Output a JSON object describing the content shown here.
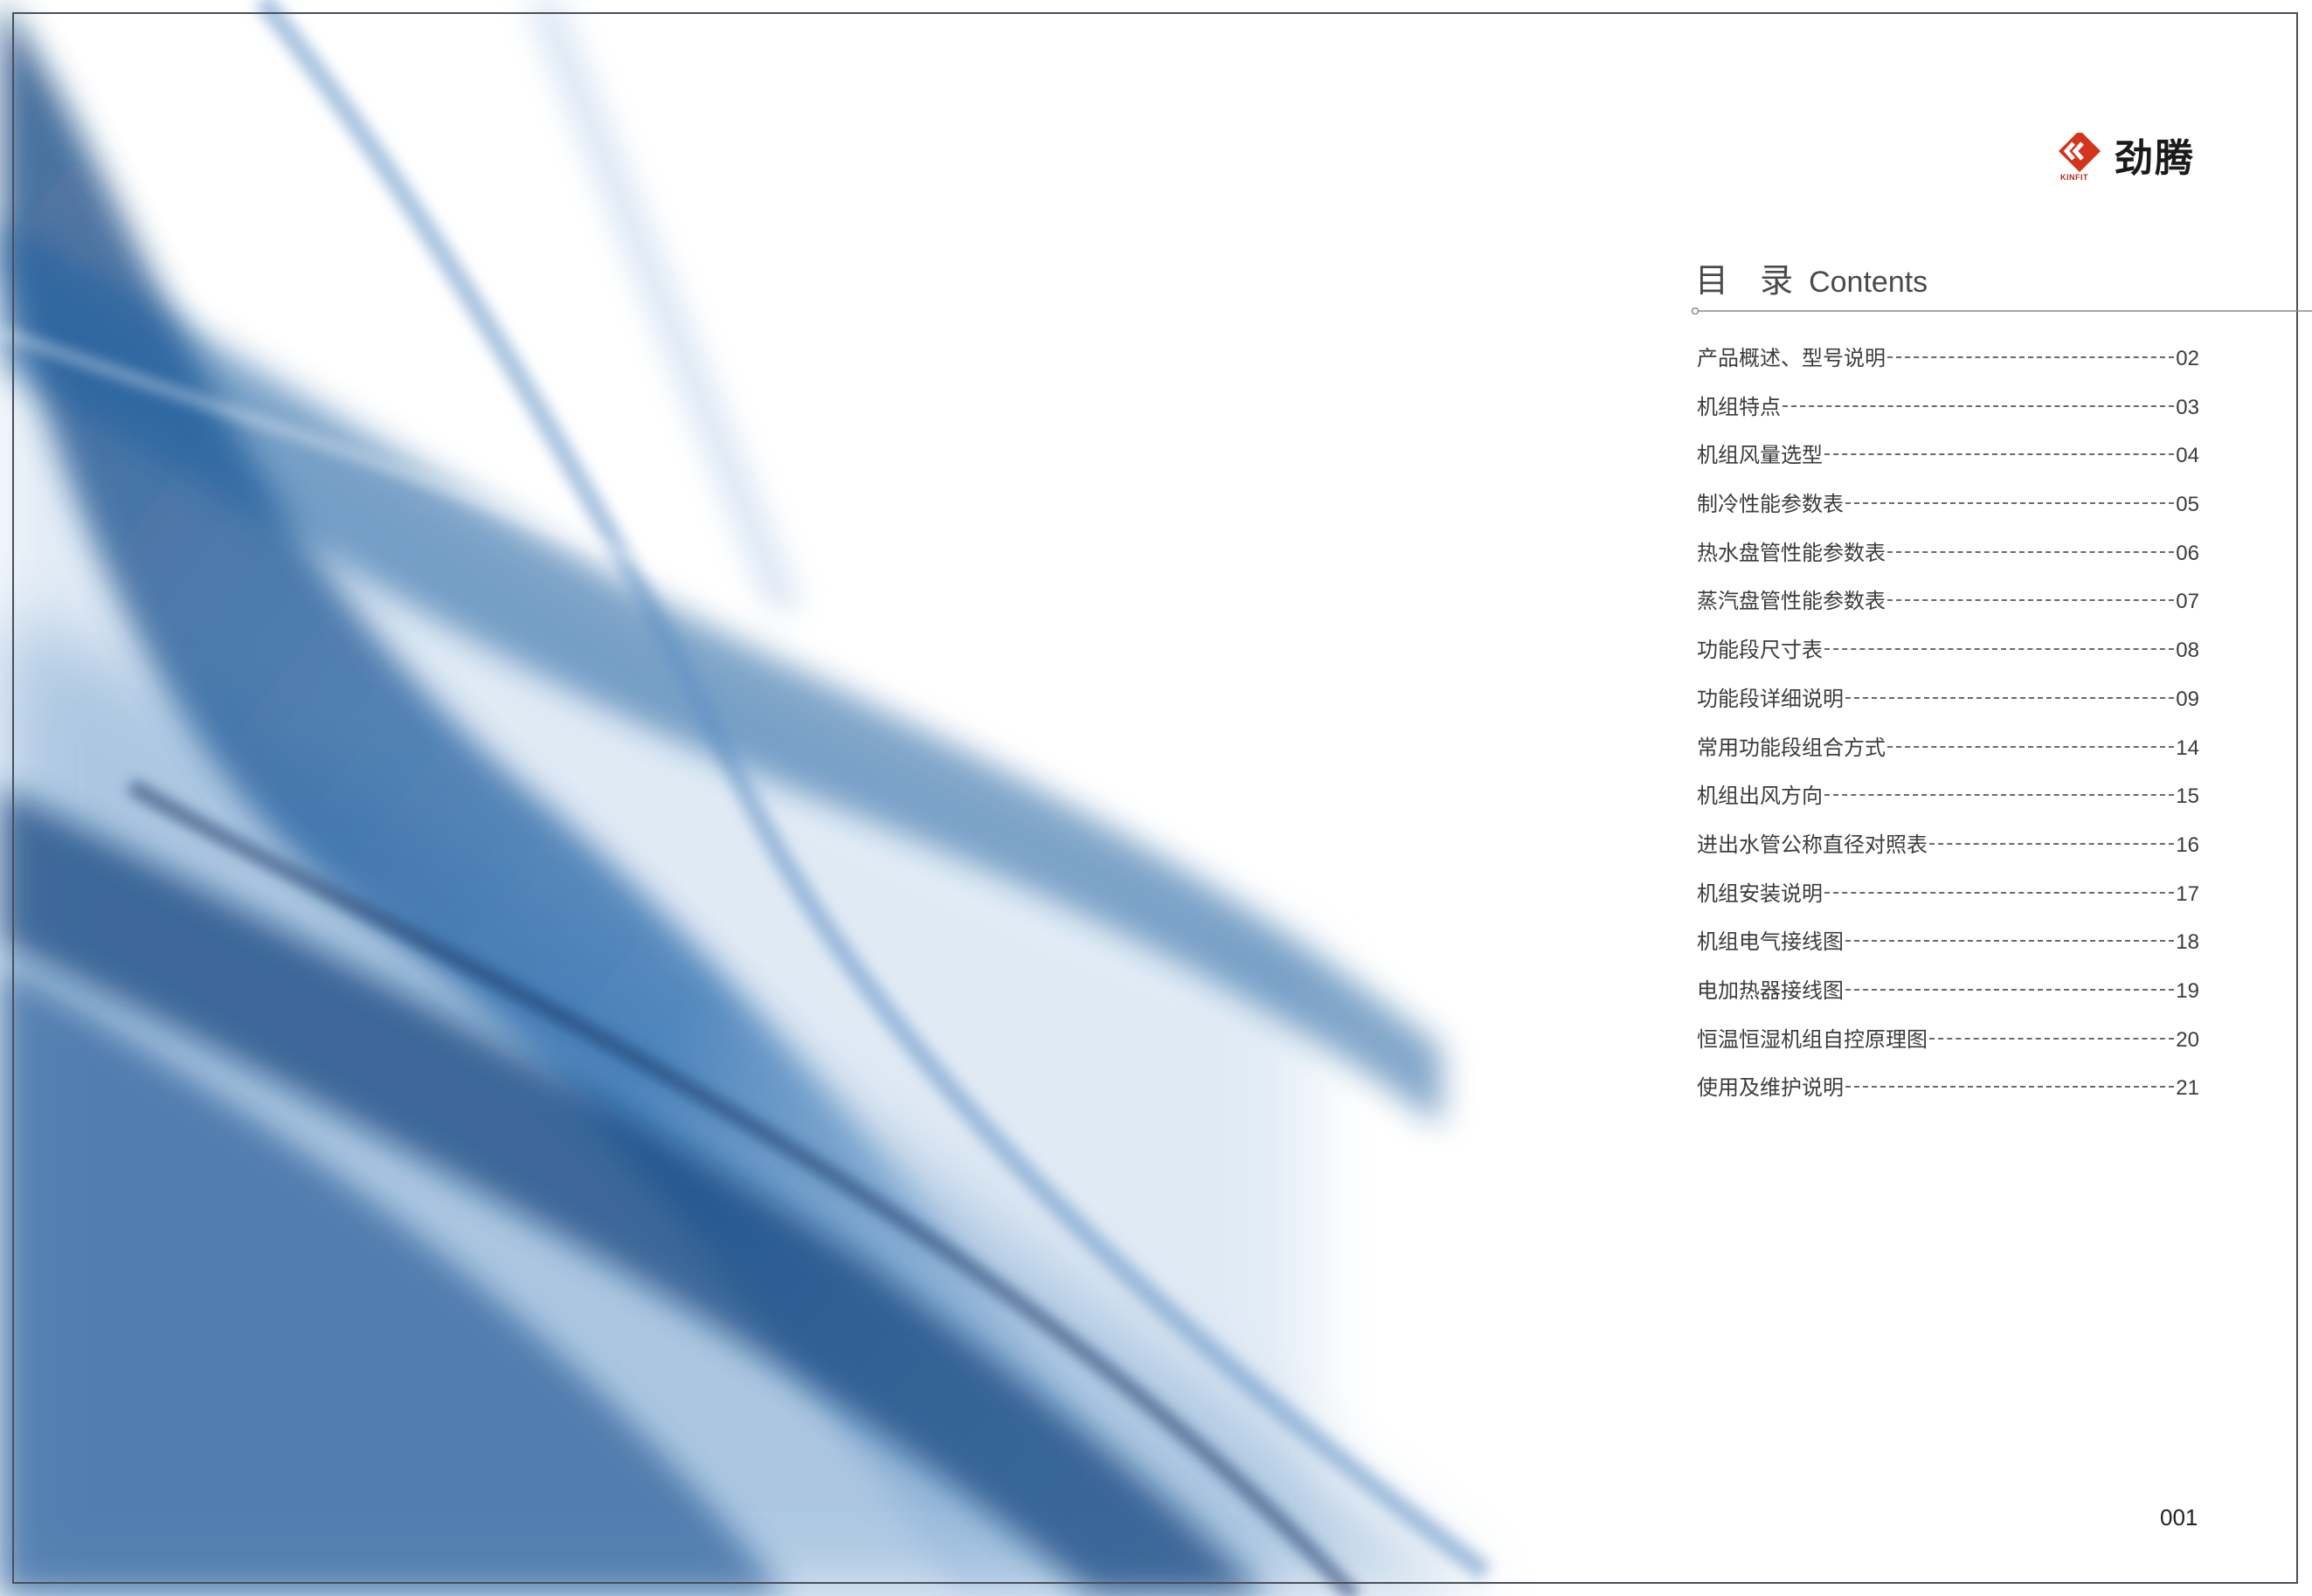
{
  "brand": {
    "name_cn": "劲腾",
    "name_en": "KINFIT",
    "accent_color": "#d2341c"
  },
  "contents": {
    "title_cn": "目 录",
    "title_en": "Contents",
    "items": [
      {
        "label": "产品概述、型号说明",
        "page": "02"
      },
      {
        "label": "机组特点",
        "page": "03"
      },
      {
        "label": "机组风量选型",
        "page": "04"
      },
      {
        "label": "制冷性能参数表",
        "page": "05"
      },
      {
        "label": "热水盘管性能参数表",
        "page": "06"
      },
      {
        "label": "蒸汽盘管性能参数表",
        "page": "07"
      },
      {
        "label": "功能段尺寸表",
        "page": "08"
      },
      {
        "label": "功能段详细说明",
        "page": "09"
      },
      {
        "label": "常用功能段组合方式",
        "page": "14"
      },
      {
        "label": "机组出风方向",
        "page": "15"
      },
      {
        "label": "进出水管公称直径对照表",
        "page": "16"
      },
      {
        "label": "机组安装说明",
        "page": "17"
      },
      {
        "label": "机组电气接线图",
        "page": "18"
      },
      {
        "label": "电加热器接线图",
        "page": "19"
      },
      {
        "label": "恒温恒湿机组自控原理图",
        "page": "20"
      },
      {
        "label": "使用及维护说明",
        "page": "21"
      }
    ]
  },
  "page_number": "001",
  "colors": {
    "wave_dark": "#0d3f7a",
    "wave_mid": "#2f6fb0",
    "wave_light": "#a9c6e4"
  }
}
